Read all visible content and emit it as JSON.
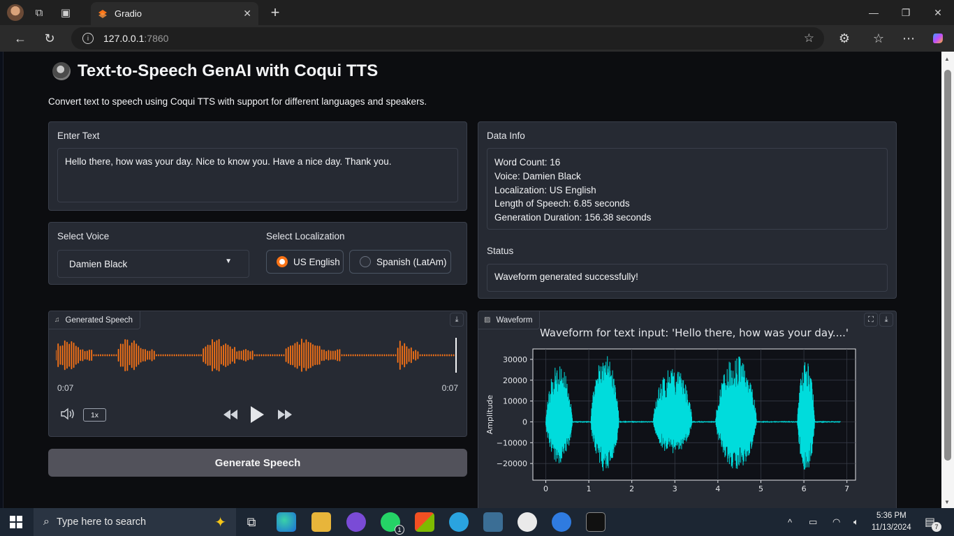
{
  "browser": {
    "tab_title": "Gradio",
    "url_host": "127.0.0.1",
    "url_port": ":7860"
  },
  "app": {
    "title": "Text-to-Speech GenAI with Coqui TTS",
    "description": "Convert text to speech using Coqui TTS with support for different languages and speakers."
  },
  "input": {
    "label": "Enter Text",
    "value": "Hello there, how was your day. Nice to know you. Have a nice day. Thank you."
  },
  "voice": {
    "label": "Select Voice",
    "value": "Damien Black"
  },
  "localization": {
    "label": "Select Localization",
    "options": [
      "US English",
      "Spanish (LatAm)"
    ],
    "selected": "US English"
  },
  "data_info": {
    "label": "Data Info",
    "lines": [
      "Word Count: 16",
      "Voice: Damien Black",
      "Localization: US English",
      "Length of Speech: 6.85 seconds",
      "Generation Duration: 156.38 seconds"
    ]
  },
  "status": {
    "label": "Status",
    "value": "Waveform generated successfully!"
  },
  "audio": {
    "label": "Generated Speech",
    "current_time": "0:07",
    "total_time": "0:07",
    "speed": "1x"
  },
  "generate_button": "Generate Speech",
  "waveform_panel": {
    "label": "Waveform"
  },
  "chart_data": {
    "type": "line",
    "title": "Waveform for text input: 'Hello there, how was your day....'",
    "xlabel": "",
    "ylabel": "Amplitude",
    "xlim": [
      -0.3,
      7.2
    ],
    "ylim": [
      -28000,
      35000
    ],
    "x_ticks": [
      0,
      1,
      2,
      3,
      4,
      5,
      6,
      7
    ],
    "y_ticks": [
      30000,
      20000,
      10000,
      0,
      -10000,
      -20000
    ],
    "y_tick_labels": [
      "30000",
      "20000",
      "10000",
      "0",
      "−10000",
      "−20000"
    ],
    "grid": true,
    "color": "#00dcdc",
    "bursts": [
      {
        "start": 0.0,
        "end": 0.62,
        "max": 28000,
        "min": -20000
      },
      {
        "start": 1.05,
        "end": 1.7,
        "max": 33000,
        "min": -24000
      },
      {
        "start": 2.5,
        "end": 3.4,
        "max": 27000,
        "min": -16000
      },
      {
        "start": 3.95,
        "end": 4.9,
        "max": 32000,
        "min": -23000
      },
      {
        "start": 5.85,
        "end": 6.25,
        "max": 30000,
        "min": -24000
      }
    ],
    "end_time": 6.85
  },
  "taskbar": {
    "search_placeholder": "Type here to search",
    "time": "5:36 PM",
    "date": "11/13/2024",
    "whatsapp_badge": "1",
    "notification_count": "7"
  }
}
